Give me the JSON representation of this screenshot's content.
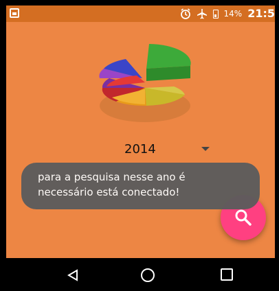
{
  "status_bar": {
    "battery": "14%",
    "time": "21:5",
    "icons": [
      "image-icon",
      "alarm-icon",
      "airplane-mode-icon",
      "battery-icon"
    ]
  },
  "colors": {
    "background": "#ED8644",
    "status_bar": "#D46E22",
    "fab": "#FF4081",
    "toast": "#5C5C5C"
  },
  "year_select": {
    "value": "2014"
  },
  "toast": {
    "message": "para a pesquisa nesse ano é necessário está conectado!"
  },
  "fab": {
    "icon": "search-icon"
  },
  "nav": {
    "back_icon": "back-icon",
    "home_icon": "home-icon",
    "recent_icon": "recent-apps-icon"
  }
}
